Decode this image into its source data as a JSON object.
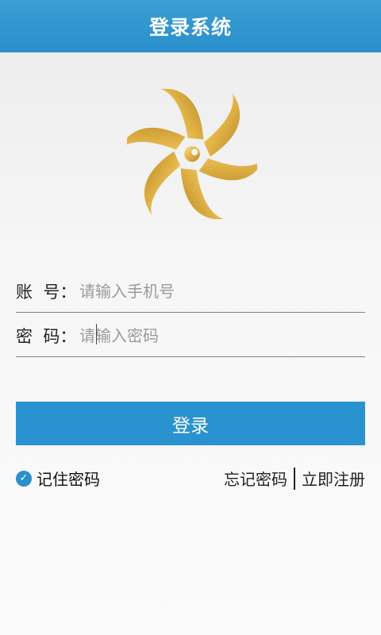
{
  "header": {
    "title": "登录系统"
  },
  "form": {
    "account": {
      "label": "账  号：",
      "placeholder": "请输入手机号"
    },
    "password": {
      "label": "密  码：",
      "placeholder": "请输入密码"
    },
    "login_label": "登录"
  },
  "options": {
    "remember_label": "记住密码",
    "remember_checked": true,
    "forgot_label": "忘记密码",
    "register_label": "立即注册"
  },
  "colors": {
    "primary": "#2a93cf",
    "logo_gold": "#e8c15a"
  },
  "icons": {
    "logo": "golden-pinwheel-logo",
    "check": "check-icon"
  }
}
